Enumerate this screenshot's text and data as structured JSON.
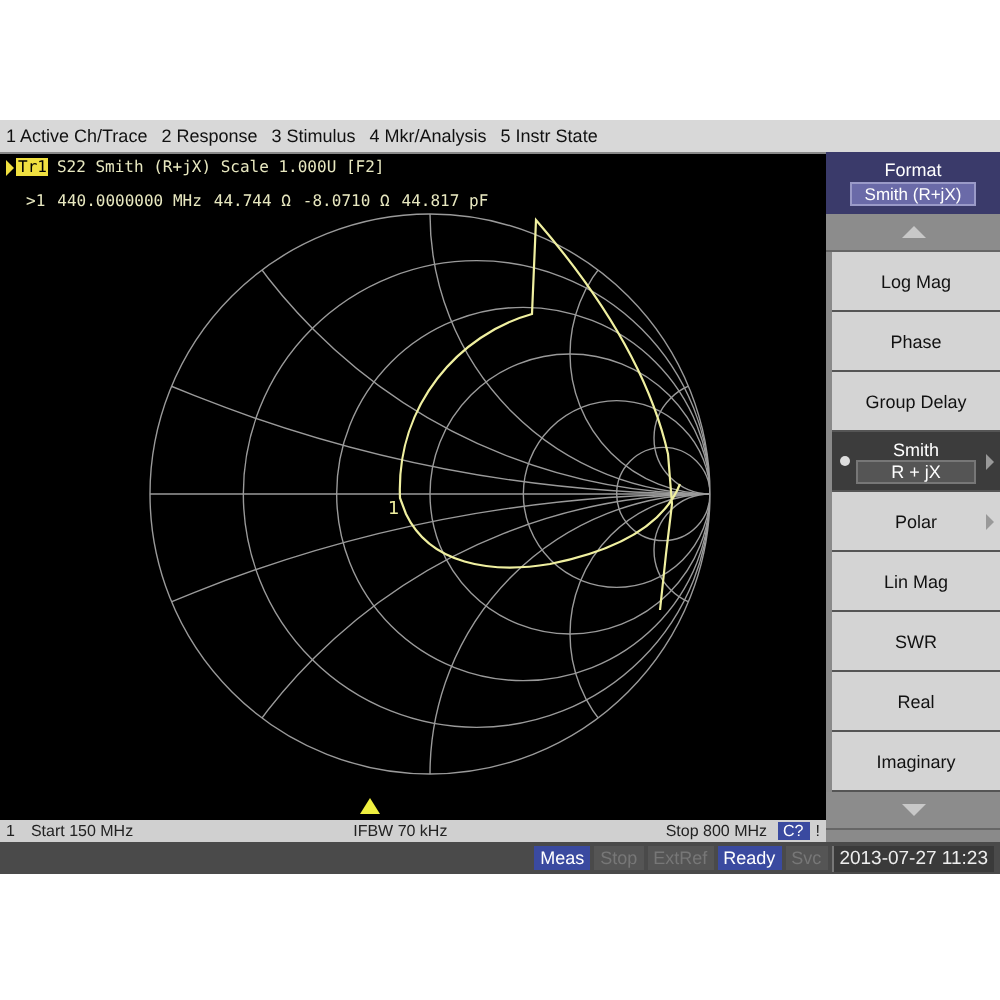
{
  "menu_bar": [
    "1 Active Ch/Trace",
    "2 Response",
    "3 Stimulus",
    "4 Mkr/Analysis",
    "5 Instr State"
  ],
  "trace_header": {
    "badge": "Tr1",
    "text": "S22 Smith (R+jX) Scale 1.000U [F2]"
  },
  "marker_readout": {
    "label": ">1",
    "frequency": "440.0000000 MHz",
    "resistance": "44.744 Ω",
    "reactance": "-8.0710 Ω",
    "value": "44.817 pF"
  },
  "marker_label": "1",
  "channel_status": {
    "channel": "1",
    "start": "Start 150 MHz",
    "ifbw": "IFBW 70 kHz",
    "stop": "Stop 800 MHz",
    "cal_badge": "C?",
    "warning": "!"
  },
  "softkeys": [
    {
      "kind": "header",
      "label": "Format",
      "value": "Smith (R+jX)"
    },
    {
      "kind": "scroll-up"
    },
    {
      "kind": "item",
      "label": "Log Mag",
      "selected": false,
      "submenu": false
    },
    {
      "kind": "item",
      "label": "Phase",
      "selected": false,
      "submenu": false
    },
    {
      "kind": "item",
      "label": "Group Delay",
      "selected": false,
      "submenu": false
    },
    {
      "kind": "item",
      "label": "Smith",
      "value": "R + jX",
      "selected": true,
      "submenu": true
    },
    {
      "kind": "item",
      "label": "Polar",
      "selected": false,
      "submenu": true
    },
    {
      "kind": "item",
      "label": "Lin Mag",
      "selected": false,
      "submenu": false
    },
    {
      "kind": "item",
      "label": "SWR",
      "selected": false,
      "submenu": false
    },
    {
      "kind": "item",
      "label": "Real",
      "selected": false,
      "submenu": false
    },
    {
      "kind": "item",
      "label": "Imaginary",
      "selected": false,
      "submenu": false
    },
    {
      "kind": "scroll-down"
    }
  ],
  "status_bar": {
    "indicators": [
      {
        "label": "Meas",
        "active": true
      },
      {
        "label": "Stop",
        "active": false
      },
      {
        "label": "ExtRef",
        "active": false
      },
      {
        "label": "Ready",
        "active": true
      },
      {
        "label": "Svc",
        "active": false
      }
    ],
    "datetime": "2013-07-27 11:23"
  }
}
